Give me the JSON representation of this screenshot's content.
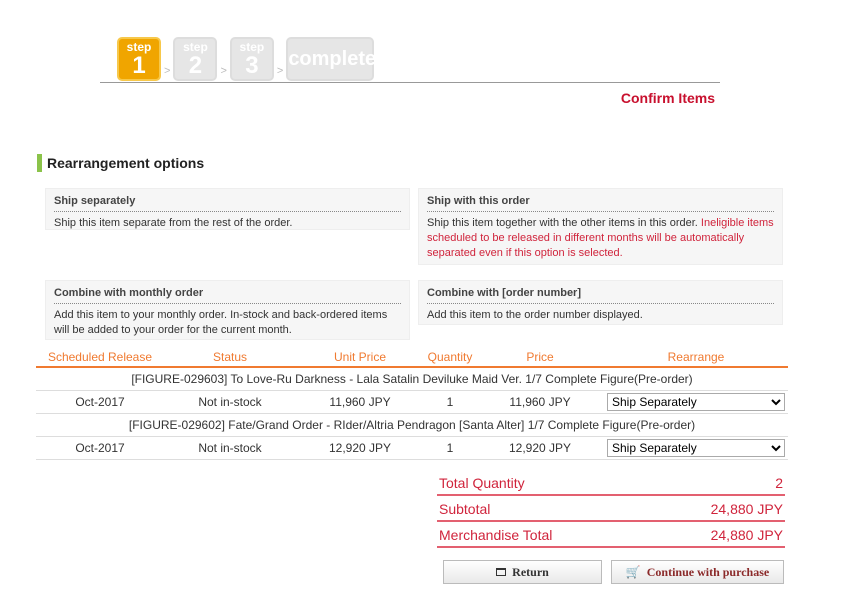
{
  "steps": [
    {
      "label": "step",
      "num": "1",
      "active": true
    },
    {
      "label": "step",
      "num": "2"
    },
    {
      "label": "step",
      "num": "3"
    },
    {
      "label": "complete"
    }
  ],
  "step_separator": ">",
  "confirm_title": "Confirm Items",
  "section_title": "Rearrangement options",
  "options": [
    {
      "title": "Ship separately",
      "text": "Ship this item separate from the rest of the order.",
      "warning": ""
    },
    {
      "title": "Ship with this order",
      "text": "Ship this item together with the other items in this order. ",
      "warning": "Ineligible items scheduled to be released in different months will be automatically separated even if this option is selected."
    },
    {
      "title": "Combine with monthly order",
      "text": "Add this item to your monthly order. In-stock and back-ordered items will be added to your order for the current month.",
      "warning": ""
    },
    {
      "title": "Combine with [order number]",
      "text": "Add this item to the order number displayed.",
      "warning": ""
    }
  ],
  "table": {
    "headers": [
      "Scheduled Release",
      "Status",
      "Unit Price",
      "Quantity",
      "Price",
      "Rearrange"
    ],
    "items": [
      {
        "title": "[FIGURE-029603] To Love-Ru Darkness - Lala Satalin Deviluke Maid Ver. 1/7 Complete Figure(Pre-order)",
        "release": "Oct-2017",
        "status": "Not in-stock",
        "unit_price": "11,960 JPY",
        "quantity": "1",
        "price": "11,960 JPY",
        "rearrange": "Ship Separately"
      },
      {
        "title": "[FIGURE-029602] Fate/Grand Order - RIder/Altria Pendragon [Santa Alter] 1/7 Complete Figure(Pre-order)",
        "release": "Oct-2017",
        "status": "Not in-stock",
        "unit_price": "12,920 JPY",
        "quantity": "1",
        "price": "12,920 JPY",
        "rearrange": "Ship Separately"
      }
    ]
  },
  "totals": [
    {
      "label": "Total Quantity",
      "value": "2"
    },
    {
      "label": "Subtotal",
      "value": "24,880 JPY"
    },
    {
      "label": "Merchandise Total",
      "value": "24,880 JPY"
    }
  ],
  "buttons": {
    "return": "Return",
    "continue": "Continue with purchase"
  },
  "colors": {
    "accent": "#f07a30",
    "total_red": "#d0243c",
    "step_active": "#f0a500",
    "section_bar": "#8bc34a"
  }
}
